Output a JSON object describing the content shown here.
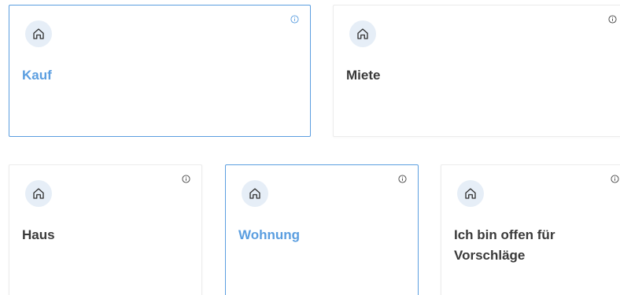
{
  "colors": {
    "accent": "#5b9ee0",
    "text": "#3a3a3a",
    "icon_bg": "#e6eef7",
    "border": "#ececec"
  },
  "transaction_options": [
    {
      "label": "Kauf",
      "icon": "house-icon",
      "info_icon": "info-icon",
      "selected": true
    },
    {
      "label": "Miete",
      "icon": "house-icon",
      "info_icon": "info-icon",
      "selected": false
    }
  ],
  "property_options": [
    {
      "label": "Haus",
      "icon": "house-icon",
      "info_icon": "info-icon",
      "selected": false
    },
    {
      "label": "Wohnung",
      "icon": "house-icon",
      "info_icon": "info-icon",
      "selected": true
    },
    {
      "label": "Ich bin offen für Vorschläge",
      "icon": "house-icon",
      "info_icon": "info-icon",
      "selected": false
    }
  ]
}
